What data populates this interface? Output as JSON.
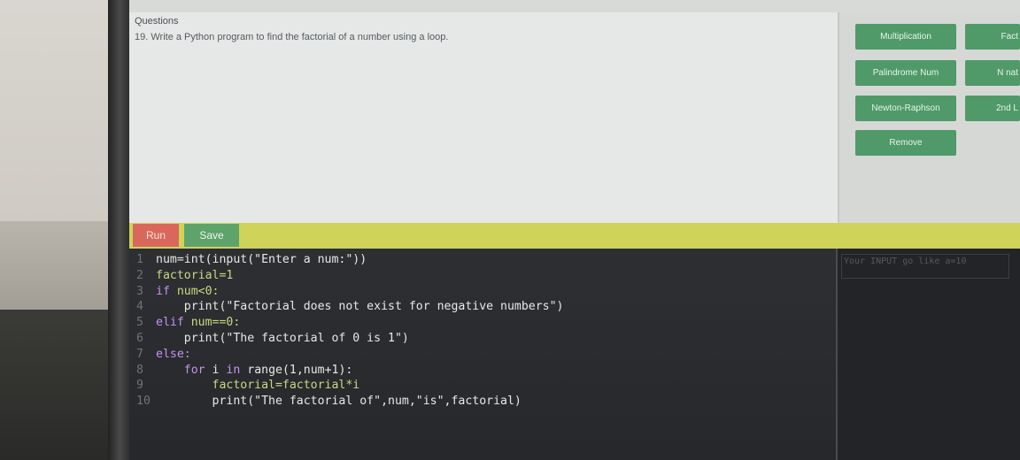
{
  "question": {
    "heading": "Questions",
    "text": "19. Write a Python program to find the factorial of a number using a loop."
  },
  "side_buttons": {
    "col1": [
      "Multiplication",
      "Palindrome Num",
      "Newton-Raphson",
      "Remove"
    ],
    "col2": [
      "Fact",
      "N nat",
      "2nd L"
    ]
  },
  "toolbar": {
    "run_label": "Run",
    "save_label": "Save"
  },
  "code_lines": [
    [
      {
        "t": "num=int(input(\"Enter a num:\"))",
        "c": "t-str"
      }
    ],
    [
      {
        "t": "factorial=1",
        "c": "t-name"
      }
    ],
    [
      {
        "t": "if ",
        "c": "t-kw"
      },
      {
        "t": "num<0:",
        "c": "t-name"
      }
    ],
    [
      {
        "t": "    print(\"Factorial does not exist for negative numbers\")",
        "c": "t-str"
      }
    ],
    [
      {
        "t": "elif ",
        "c": "t-kw"
      },
      {
        "t": "num==0:",
        "c": "t-name"
      }
    ],
    [
      {
        "t": "    print(\"The factorial of 0 is 1\")",
        "c": "t-str"
      }
    ],
    [
      {
        "t": "else:",
        "c": "t-kw"
      }
    ],
    [
      {
        "t": "    for ",
        "c": "t-kw"
      },
      {
        "t": "i ",
        "c": "t-str"
      },
      {
        "t": "in ",
        "c": "t-kw"
      },
      {
        "t": "range(1,num+1):",
        "c": "t-str"
      }
    ],
    [
      {
        "t": "        factorial=factorial*i",
        "c": "t-name"
      }
    ],
    [
      {
        "t": "        print(\"The factorial of\",num,\"is\",factorial)",
        "c": "t-str"
      }
    ]
  ],
  "console": {
    "placeholder": "Your INPUT go like a=10"
  }
}
